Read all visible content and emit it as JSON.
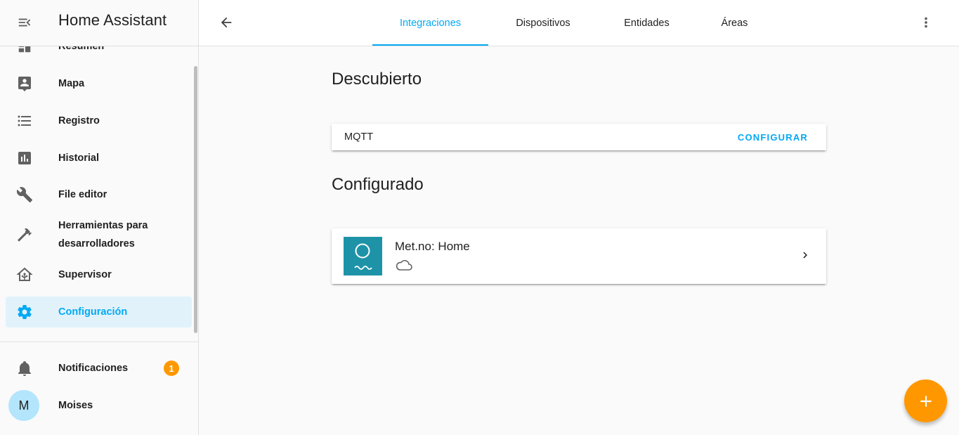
{
  "sidebar": {
    "title": "Home Assistant",
    "items": [
      {
        "label": "Resumen",
        "icon": "dashboard-icon"
      },
      {
        "label": "Mapa",
        "icon": "map-account-icon"
      },
      {
        "label": "Registro",
        "icon": "format-list-icon"
      },
      {
        "label": "Historial",
        "icon": "chart-box-icon"
      },
      {
        "label": "File editor",
        "icon": "wrench-icon"
      },
      {
        "label": "Herramientas para desarrolladores",
        "icon": "hammer-icon"
      },
      {
        "label": "Supervisor",
        "icon": "home-assistant-icon"
      },
      {
        "label": "Configuración",
        "icon": "gear-icon"
      }
    ],
    "notifications": {
      "label": "Notificaciones",
      "count": "1"
    },
    "user": {
      "initial": "M",
      "name": "Moises"
    }
  },
  "topbar": {
    "tabs": [
      {
        "label": "Integraciones"
      },
      {
        "label": "Dispositivos"
      },
      {
        "label": "Entidades"
      },
      {
        "label": "Áreas"
      }
    ]
  },
  "main": {
    "discovered_title": "Descubierto",
    "discovered": [
      {
        "name": "MQTT",
        "action": "CONFIGURAR"
      }
    ],
    "configured_title": "Configurado",
    "configured": [
      {
        "name": "Met.no: Home"
      }
    ]
  },
  "colors": {
    "accent": "#03a9f4",
    "fab": "#ff9800",
    "logo_bg": "#1e93a8"
  }
}
